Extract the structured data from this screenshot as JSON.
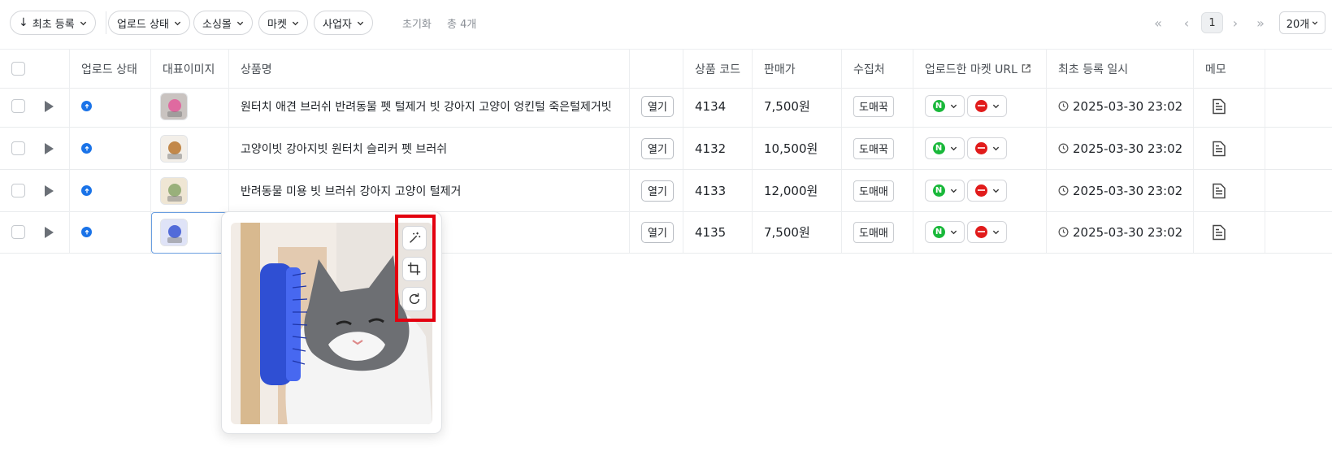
{
  "toolbar": {
    "sort_label": "최초 등록",
    "filters": [
      "업로드 상태",
      "소싱몰",
      "마켓",
      "사업자"
    ],
    "reset_label": "초기화",
    "total_label": "총 4개",
    "pagination": {
      "current_page": "1",
      "per_page_label": "20개"
    }
  },
  "table": {
    "headers": {
      "upload_status": "업로드 상태",
      "main_image": "대표이미지",
      "product_name": "상품명",
      "product_code": "상품 코드",
      "price": "판매가",
      "source": "수집처",
      "market_url": "업로드한 마켓 URL",
      "created_at": "최초 등록 일시",
      "memo": "메모"
    },
    "rows": [
      {
        "name": "원터치 애견 브러쉬 반려동물 펫 털제거 빗 강아지 고양이 엉킨털 죽은털제거빗",
        "open_label": "열기",
        "code": "4134",
        "price": "7,500원",
        "source": "도매꾹",
        "created_at": "2025-03-30 23:02"
      },
      {
        "name": "고양이빗 강아지빗 원터치 슬리커 펫 브러쉬",
        "open_label": "열기",
        "code": "4132",
        "price": "10,500원",
        "source": "도매꾹",
        "created_at": "2025-03-30 23:02"
      },
      {
        "name": "반려동물 미용 빗 브러쉬 강아지 고양이 털제거",
        "open_label": "열기",
        "code": "4133",
        "price": "12,000원",
        "source": "도매매",
        "created_at": "2025-03-30 23:02"
      },
      {
        "name": "",
        "open_label": "열기",
        "code": "4135",
        "price": "7,500원",
        "source": "도매매",
        "created_at": "2025-03-30 23:02"
      }
    ]
  },
  "markets": {
    "naver_badge": "N"
  },
  "colors": {
    "accent_blue": "#1a73e8",
    "naver_green": "#19b83a",
    "coupang_red": "#e11b1b",
    "highlight_red": "#e3000f"
  },
  "icons": [
    "arrow-down-icon",
    "chevron-down-icon",
    "first-page-icon",
    "prev-page-icon",
    "next-page-icon",
    "last-page-icon",
    "external-link-icon",
    "play-icon",
    "upload-icon",
    "clock-icon",
    "memo-icon",
    "magic-wand-icon",
    "crop-icon",
    "rotate-icon"
  ]
}
